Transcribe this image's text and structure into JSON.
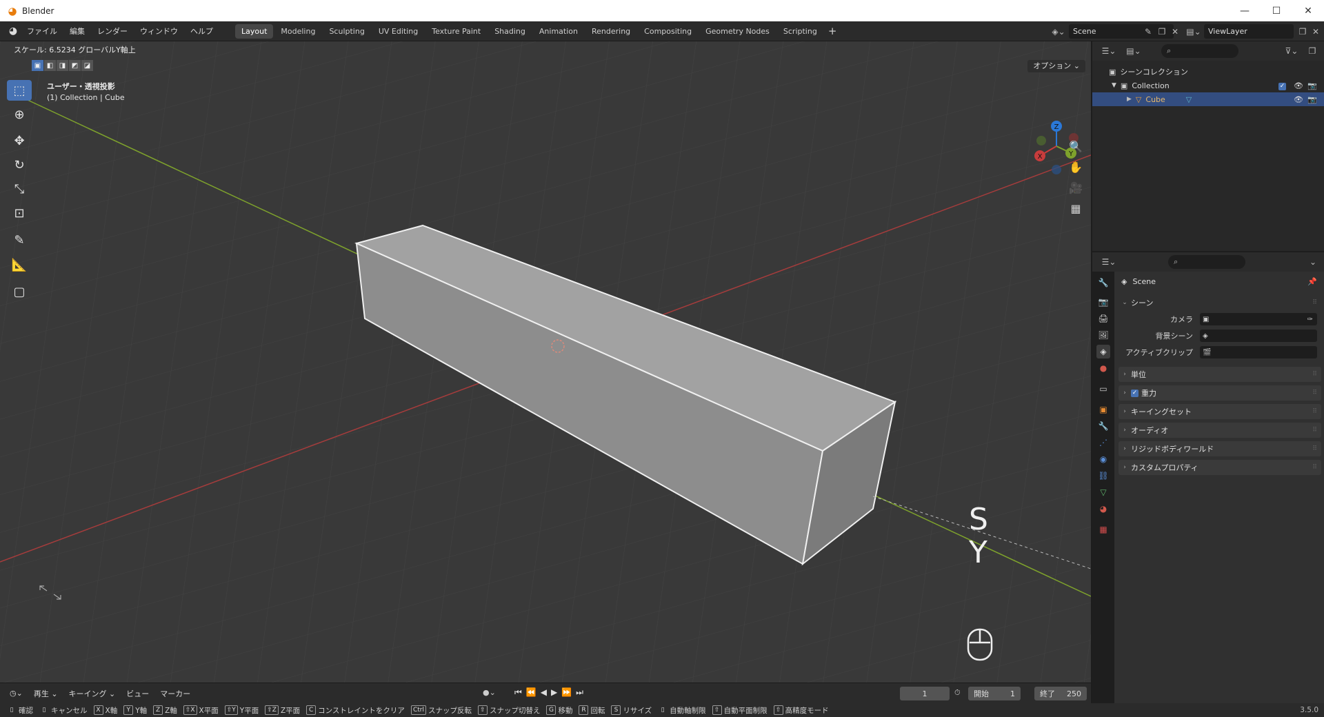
{
  "window": {
    "title": "Blender"
  },
  "menu": [
    "ファイル",
    "編集",
    "レンダー",
    "ウィンドウ",
    "ヘルプ"
  ],
  "workspaces": [
    "Layout",
    "Modeling",
    "Sculpting",
    "UV Editing",
    "Texture Paint",
    "Shading",
    "Animation",
    "Rendering",
    "Compositing",
    "Geometry Nodes",
    "Scripting"
  ],
  "active_workspace": "Layout",
  "scene_name": "Scene",
  "view_layer": "ViewLayer",
  "viewport": {
    "header_status": "スケール: 6.5234 グローバルY軸上",
    "view_name": "ユーザー・透視投影",
    "view_object": "(1) Collection | Cube",
    "options_label": "オプション ⌄",
    "modal_keys": [
      "S",
      "Y"
    ],
    "gizmo_axes": [
      "Z",
      "Y",
      "X"
    ]
  },
  "tools": [
    "select-box",
    "cursor",
    "move",
    "rotate",
    "scale",
    "transform",
    "annotate",
    "measure",
    "add-cube"
  ],
  "outliner": {
    "root": "シーンコレクション",
    "collection": "Collection",
    "object": "Cube"
  },
  "properties": {
    "context_title": "Scene",
    "scene_panel": "シーン",
    "fields": [
      {
        "label": "カメラ"
      },
      {
        "label": "背景シーン"
      },
      {
        "label": "アクティブクリップ"
      }
    ],
    "panels": [
      "単位",
      "重力",
      "キーイングセット",
      "オーディオ",
      "リジッドボディワールド",
      "カスタムプロパティ"
    ]
  },
  "timeline": {
    "menus": [
      "再生 ⌄",
      "キーイング ⌄",
      "ビュー",
      "マーカー"
    ],
    "current_frame": "1",
    "start_label": "開始",
    "start": "1",
    "end_label": "終了",
    "end": "250"
  },
  "statusbar": {
    "items": [
      {
        "key": "",
        "text": "確認"
      },
      {
        "key": "",
        "text": "キャンセル"
      },
      {
        "key": "X",
        "text": "X軸"
      },
      {
        "key": "Y",
        "text": "Y軸"
      },
      {
        "key": "Z",
        "text": "Z軸"
      },
      {
        "key": "⇧X",
        "text": "X平面"
      },
      {
        "key": "⇧Y",
        "text": "Y平面"
      },
      {
        "key": "⇧Z",
        "text": "Z平面"
      },
      {
        "key": "C",
        "text": "コンストレイントをクリア"
      },
      {
        "key": "Ctrl",
        "text": "スナップ反転"
      },
      {
        "key": "⇧",
        "text": "スナップ切替え"
      },
      {
        "key": "G",
        "text": "移動"
      },
      {
        "key": "R",
        "text": "回転"
      },
      {
        "key": "S",
        "text": "リサイズ"
      },
      {
        "key": "",
        "text": "自動軸制限"
      },
      {
        "key": "⇧",
        "text": "自動平面制限"
      },
      {
        "key": "⇧",
        "text": "高精度モード"
      }
    ],
    "version": "3.5.0"
  },
  "colors": {
    "selection": "#4772b3",
    "x_axis": "#a63c3c",
    "y_axis": "#7ea22c",
    "outliner_selected": "#334d80",
    "active_object_text": "#e8b86a"
  }
}
